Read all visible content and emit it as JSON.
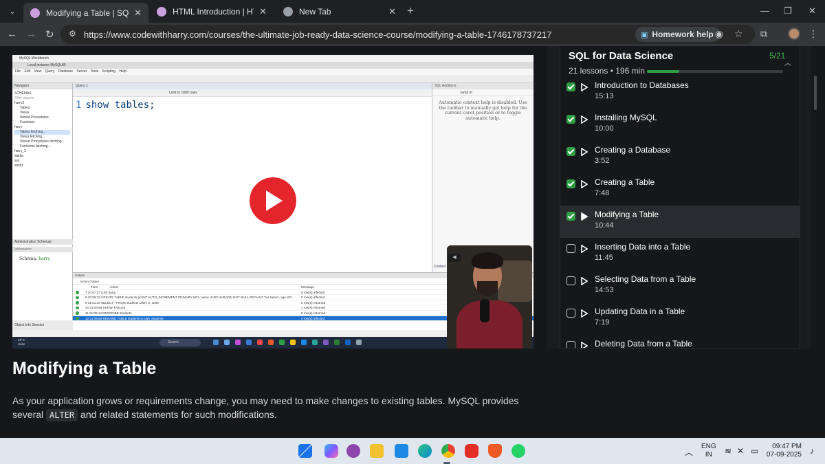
{
  "browser": {
    "tabs": [
      {
        "title": "Modifying a Table | SQL for Data Science",
        "favicon_color": "#c9a0dc",
        "active": true
      },
      {
        "title": "HTML Introduction | HTML Tutorial",
        "favicon_color": "#c9a0dc",
        "active": false
      },
      {
        "title": "New Tab",
        "favicon_color": "#9aa0a6",
        "active": false
      }
    ],
    "url": "https://www.codewithharry.com/courses/the-ultimate-job-ready-data-science-course/modifying-a-table-1746178737217",
    "homework_label": "Homework help"
  },
  "video": {
    "workbench": {
      "app_title": "MySQL Workbench",
      "connection_tab": "Local instance MySQL80",
      "menu": [
        "File",
        "Edit",
        "View",
        "Query",
        "Database",
        "Server",
        "Tools",
        "Scripting",
        "Help"
      ],
      "navigator_header": "Navigator",
      "schemas_label": "SCHEMAS",
      "filter_placeholder": "Filter objects",
      "schema_tree": [
        "harry2",
        "Tables",
        "Views",
        "Stored Procedures",
        "Functions",
        "harry",
        "Tables fetching...",
        "Views fetching...",
        "Stored Procedures fetching...",
        "Functions fetching...",
        "harry_2",
        "sakila",
        "sys",
        "world"
      ],
      "query_tab": "Query 1",
      "limit_label": "Limit to 1000 rows",
      "code_line_number": "1",
      "code": "show tables;",
      "sql_additions_header": "SQL Additions",
      "jump_to": "Jump to",
      "context_help": "Automatic context help is disabled. Use the toolbar to manually get help for the current caret position or to toggle automatic help.",
      "admin_tabs": "Administration   Schemas",
      "information_label": "Information",
      "schema_label": "Schema:",
      "schema_name": "harry",
      "object_info_tabs": "Object Info   Session",
      "output_header": "Output",
      "action_output": "Action Output",
      "output_columns": {
        "time": "Time",
        "action": "Action",
        "message": "Message"
      },
      "output_rows": [
        {
          "n": "7",
          "time": "20:57:27",
          "action": "USE harry",
          "message": "0 row(s) affected"
        },
        {
          "n": "8",
          "time": "20:59:23",
          "action": "CREATE TABLE students (id INT AUTO_INCREMENT PRIMARY KEY,  name VARCHAR(100) NOT NULL DEFAULT 'No Name',  age INT,  email V...",
          "message": "0 row(s) affected"
        },
        {
          "n": "9",
          "time": "21:01:19",
          "action": "SELECT * FROM students LIMIT 0, 1000",
          "message": "0 row(s) returned"
        },
        {
          "n": "10",
          "time": "21:04:59",
          "action": "SHOW TABLES",
          "message": "1 row(s) returned"
        },
        {
          "n": "11",
          "time": "21:05:14",
          "action": "DESCRIBE students",
          "message": "5 row(s) returned"
        },
        {
          "n": "12",
          "time": "21:36:59",
          "action": "RENAME TABLE students to cwh_students",
          "message": "0 row(s) affected"
        }
      ],
      "context_help_footer": "Context Help"
    },
    "inner_taskbar": {
      "weather_temp": "28°C",
      "weather_text": "Haze",
      "search_label": "Search"
    }
  },
  "content": {
    "title": "Modifying a Table",
    "paragraph_before": "As your application grows or requirements change, you may need to make changes to existing tables. MySQL provides several ",
    "code_keyword": "ALTER",
    "paragraph_after": " and related statements for such modifications."
  },
  "course": {
    "title": "SQL for Data Science",
    "completed": "5/21",
    "meta": "21 lessons • 196 min",
    "progress_fraction": 0.238,
    "lessons": [
      {
        "name": "Introduction to Databases",
        "duration": "15:13",
        "done": true,
        "current": false
      },
      {
        "name": "Installing MySQL",
        "duration": "10:00",
        "done": true,
        "current": false
      },
      {
        "name": "Creating a Database",
        "duration": "3:52",
        "done": true,
        "current": false
      },
      {
        "name": "Creating a Table",
        "duration": "7:48",
        "done": true,
        "current": false
      },
      {
        "name": "Modifying a Table",
        "duration": "10:44",
        "done": true,
        "current": true
      },
      {
        "name": "Inserting Data into a Table",
        "duration": "11:45",
        "done": false,
        "current": false
      },
      {
        "name": "Selecting Data from a Table",
        "duration": "14:53",
        "done": false,
        "current": false
      },
      {
        "name": "Updating Data in a Table",
        "duration": "7:19",
        "done": false,
        "current": false
      },
      {
        "name": "Deleting Data from a Table",
        "duration": "",
        "done": false,
        "current": false
      }
    ]
  },
  "taskbar": {
    "lang_top": "ENG",
    "lang_bottom": "IN",
    "time": "09:47 PM",
    "date": "07-09-2025",
    "apps": [
      {
        "name": "start",
        "color": "#1a73e8"
      },
      {
        "name": "copilot",
        "color": "#7b5cff"
      },
      {
        "name": "github-desktop",
        "color": "#8e44ad"
      },
      {
        "name": "file-explorer",
        "color": "#f2c12e"
      },
      {
        "name": "vscode",
        "color": "#1e88e5"
      },
      {
        "name": "edge",
        "color": "#0d8bd6"
      },
      {
        "name": "chrome",
        "color": "#34a853"
      },
      {
        "name": "youtube",
        "color": "#e52d27"
      },
      {
        "name": "brave",
        "color": "#f05a24"
      },
      {
        "name": "whatsapp",
        "color": "#25d366"
      }
    ]
  }
}
